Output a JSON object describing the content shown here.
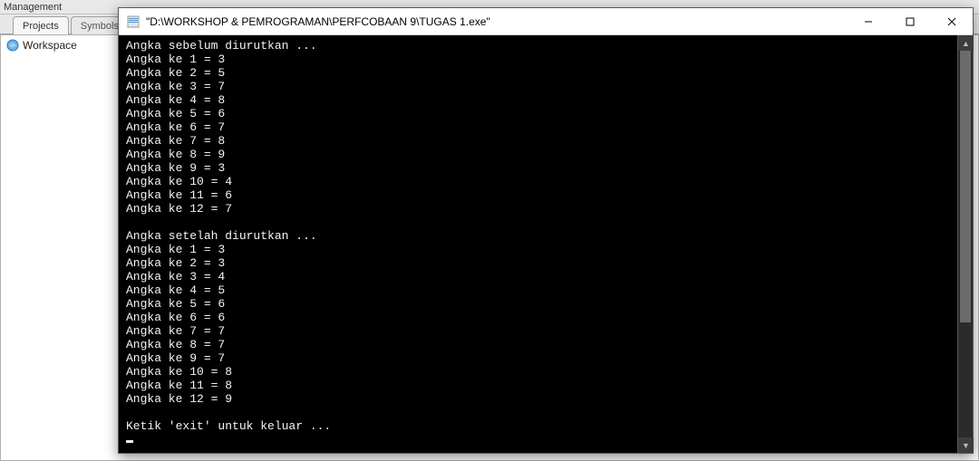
{
  "ide": {
    "panel_title": "Management",
    "tabs": [
      {
        "label": "Projects",
        "active": true
      },
      {
        "label": "Symbols",
        "active": false
      }
    ],
    "tree_item": "Workspace"
  },
  "console": {
    "title": "\"D:\\WORKSHOP & PEMROGRAMAN\\PERFCOBAAN 9\\TUGAS 1.exe\"",
    "header_before": "Angka sebelum diurutkan ...",
    "before": [
      "Angka ke 1 = 3",
      "Angka ke 2 = 5",
      "Angka ke 3 = 7",
      "Angka ke 4 = 8",
      "Angka ke 5 = 6",
      "Angka ke 6 = 7",
      "Angka ke 7 = 8",
      "Angka ke 8 = 9",
      "Angka ke 9 = 3",
      "Angka ke 10 = 4",
      "Angka ke 11 = 6",
      "Angka ke 12 = 7"
    ],
    "header_after": "Angka setelah diurutkan ...",
    "after": [
      "Angka ke 1 = 3",
      "Angka ke 2 = 3",
      "Angka ke 3 = 4",
      "Angka ke 4 = 5",
      "Angka ke 5 = 6",
      "Angka ke 6 = 6",
      "Angka ke 7 = 7",
      "Angka ke 8 = 7",
      "Angka ke 9 = 7",
      "Angka ke 10 = 8",
      "Angka ke 11 = 8",
      "Angka ke 12 = 9"
    ],
    "footer": "Ketik 'exit' untuk keluar ..."
  }
}
